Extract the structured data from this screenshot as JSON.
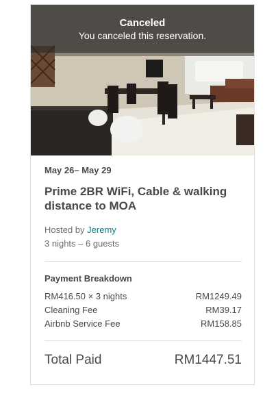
{
  "banner": {
    "title": "Canceled",
    "subtitle": "You canceled this reservation."
  },
  "reservation": {
    "dates": "May 26– May 29",
    "title": "Prime 2BR WiFi, Cable & walking distance to MOA",
    "hosted_by_label": "Hosted by",
    "host_name": "Jeremy",
    "nights_guests": "3 nights – 6 guests"
  },
  "payment": {
    "heading": "Payment Breakdown",
    "rows": [
      {
        "label": "RM416.50 × 3 nights",
        "value": "RM1249.49"
      },
      {
        "label": "Cleaning Fee",
        "value": "RM39.17"
      },
      {
        "label": "Airbnb Service Fee",
        "value": "RM158.85"
      }
    ],
    "total_label": "Total Paid",
    "total_value": "RM1447.51"
  },
  "colors": {
    "text": "#484848",
    "muted": "#6d6d6d",
    "link": "#008489",
    "divider": "#dce0e0"
  }
}
